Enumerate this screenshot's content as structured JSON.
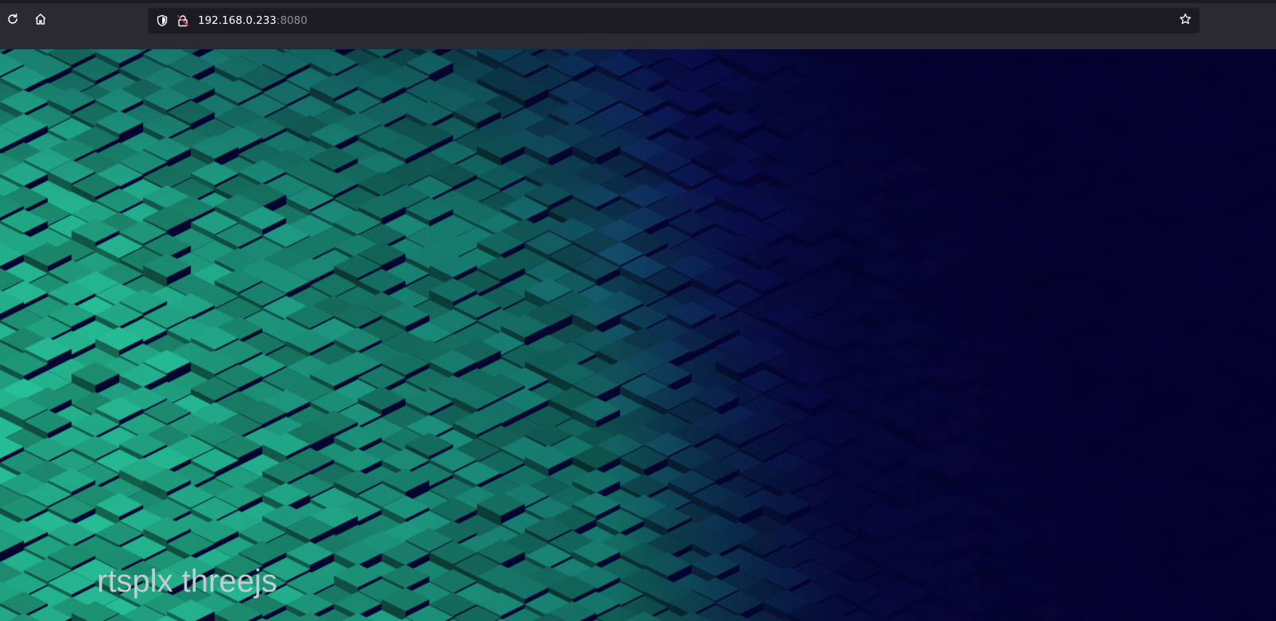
{
  "browser": {
    "url_host": "192.168.0.233",
    "url_port": ":8080",
    "icons": {
      "reload": "reload-icon",
      "home": "home-icon",
      "tracking_protection": "shield-icon",
      "insecure_lock": "insecure-lock-icon",
      "bookmark": "star-icon"
    },
    "colors": {
      "toolbar": "#2b2a33",
      "urlbar": "#1c1b22",
      "text": "#fbfbfe",
      "port_text": "#8f8f9d",
      "insecure": "#e22850"
    }
  },
  "page": {
    "title": "rtsplx threejs",
    "colors": {
      "background": "#04022e",
      "cube_teal": "#1fa683",
      "cube_navy": "#0a0f5a",
      "title_text": "#c4ccd0"
    }
  }
}
